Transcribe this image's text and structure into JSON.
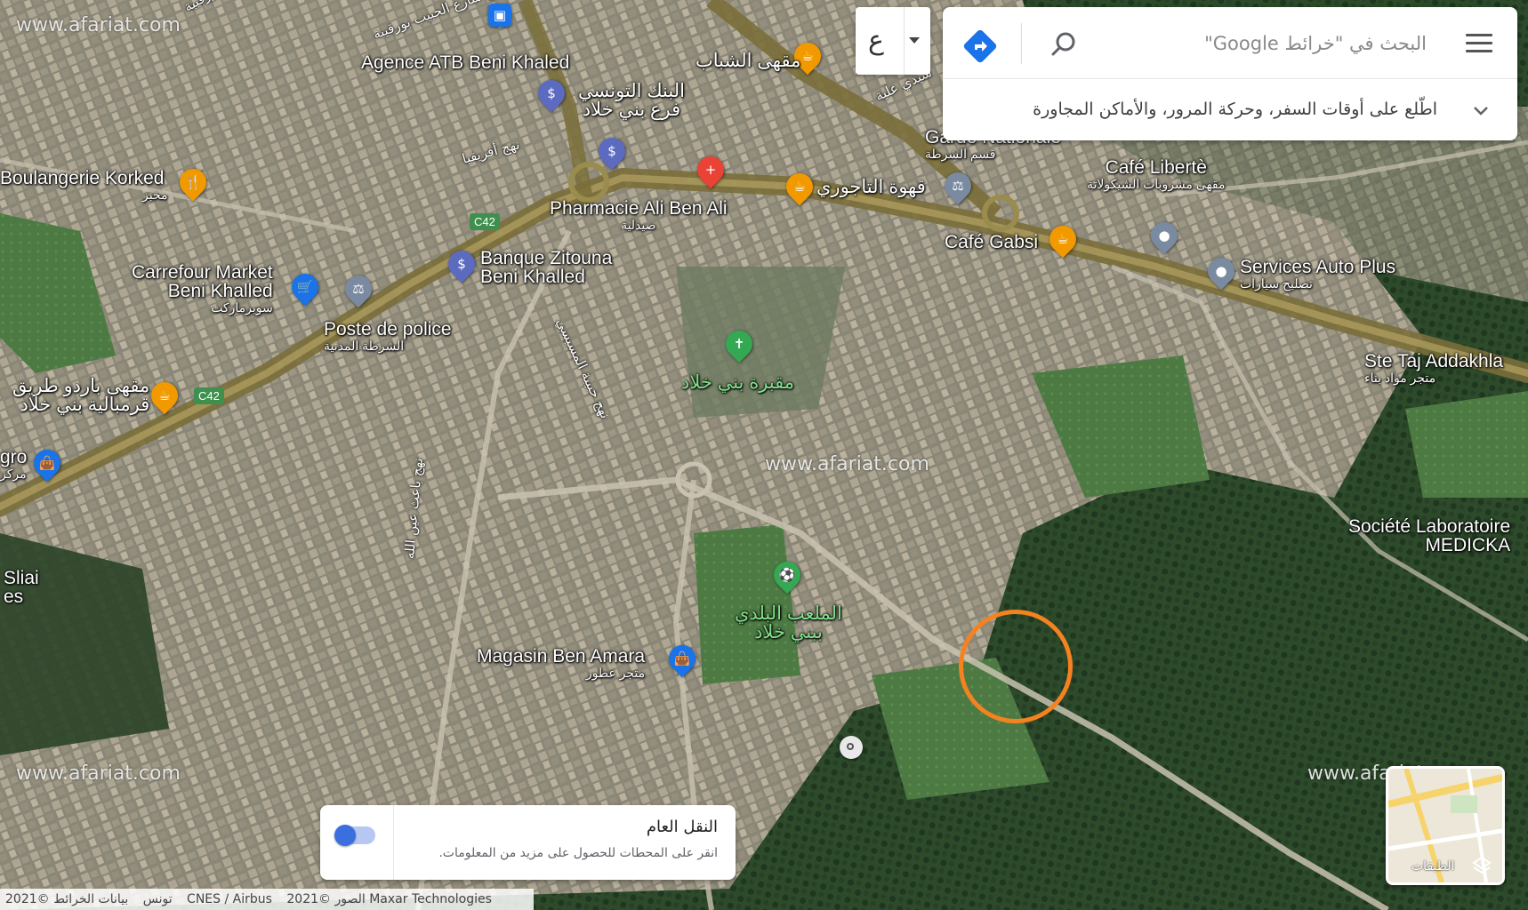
{
  "search": {
    "placeholder": "البحث في \"خرائط Google\"",
    "suggestion": "اطّلع على أوقات السفر، وحركة المرور، والأماكن المجاورة"
  },
  "language": {
    "label": "ع"
  },
  "transit": {
    "title": "النقل العام",
    "description": "انقر على المحطات للحصول على مزيد من المعلومات.",
    "enabled": true
  },
  "layers": {
    "label": "الطبقات"
  },
  "attribution": {
    "imagery": "الصور ©2021 Maxar Technologies",
    "data": "CNES / Airbus",
    "map_data": "بيانات الخرائط ©2021",
    "country": "تونس"
  },
  "watermarks": [
    "www.afariat.com",
    "www.afariat.com",
    "www.afariat.com",
    "www.afariat.com"
  ],
  "places": [
    {
      "name": "Agence ATB Beni Khaled",
      "sub": ""
    },
    {
      "name": "البنك التونسي",
      "sub": "فرع بني خلاد"
    },
    {
      "name": "مقهى الشباب",
      "sub": ""
    },
    {
      "name": "Garde Nationale",
      "sub": "قسم الشرطة"
    },
    {
      "name": "Café Libertè",
      "sub": "مقهى مشروبات الشيكولاتة"
    },
    {
      "name": "Boulangerie Korked",
      "sub": "مخبز"
    },
    {
      "name": "Pharmacie Ali Ben Ali",
      "sub": "صيدلية"
    },
    {
      "name": "قهوة التاجوري",
      "sub": ""
    },
    {
      "name": "Café Gabsi",
      "sub": ""
    },
    {
      "name": "Services Auto Plus",
      "sub": "تصليح سيارات"
    },
    {
      "name": "Banque Zitouna",
      "sub": "Beni Khalled"
    },
    {
      "name": "Carrefour Market",
      "sub": "Beni Khalled"
    },
    {
      "name": "سوبرماركت",
      "sub": ""
    },
    {
      "name": "Poste de police",
      "sub": "الشرطة المدنية"
    },
    {
      "name": "مقبرة بني خلاد",
      "sub": ""
    },
    {
      "name": "مقهى باردو طريق",
      "sub": "قرمبالية بني خلاد"
    },
    {
      "name": "Ste Taj Addakhla",
      "sub": "متجر مواد بناء"
    },
    {
      "name": "Société Laboratoire",
      "sub": "MEDICKA"
    },
    {
      "name": "الملعب البلدي",
      "sub": "ببني خلاد"
    },
    {
      "name": "Magasin Ben Amara",
      "sub": "متجر عطور"
    },
    {
      "name": "gro",
      "sub": "مركز"
    },
    {
      "name": "Sliai",
      "sub": "es"
    }
  ],
  "streets": [
    "نهج أفريقيا",
    "نهج شارع الحبيب بورقيبة",
    "نهج حبيبة المسيسي",
    "نهج باعث عين الله",
    "مورقيبة",
    "سيدي علية"
  ],
  "roads": [
    "C42",
    "C42"
  ],
  "colors": {
    "highlight": "#f58220",
    "directions": "#1a73e8",
    "toggle": "#3b6fe0"
  }
}
